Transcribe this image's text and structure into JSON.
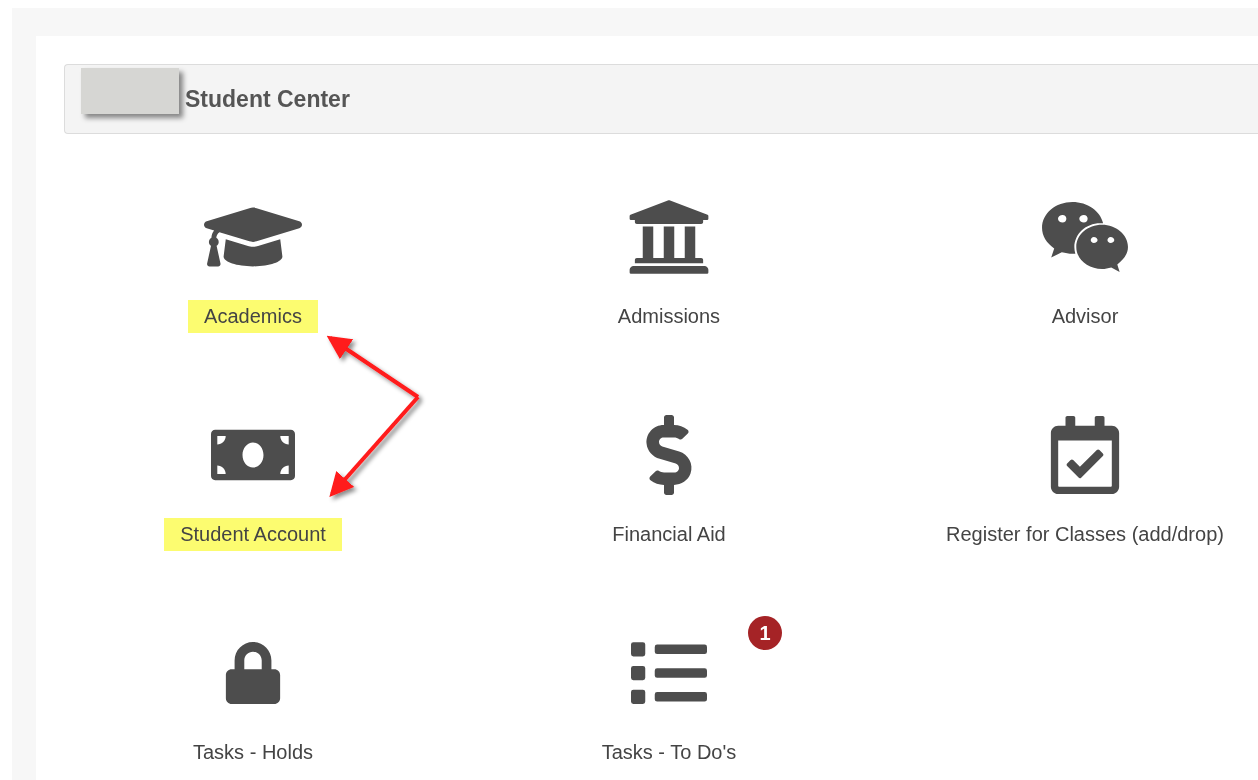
{
  "header": {
    "title": "Student Center"
  },
  "tiles": [
    {
      "label": "Academics",
      "highlighted": true
    },
    {
      "label": "Admissions",
      "highlighted": false
    },
    {
      "label": "Advisor",
      "highlighted": false
    },
    {
      "label": "Student Account",
      "highlighted": true
    },
    {
      "label": "Financial Aid",
      "highlighted": false
    },
    {
      "label": "Register for Classes (add/drop)",
      "highlighted": false
    },
    {
      "label": "Tasks - Holds",
      "highlighted": false
    },
    {
      "label": "Tasks - To Do's",
      "highlighted": false,
      "badge": "1"
    }
  ]
}
